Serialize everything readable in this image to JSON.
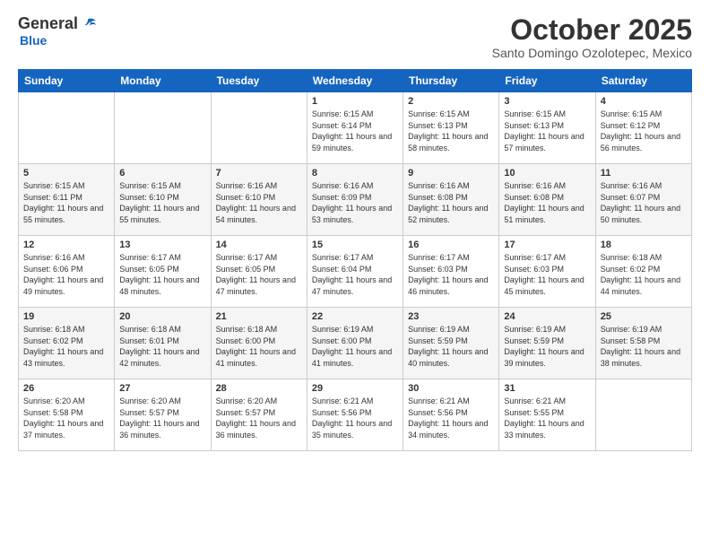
{
  "logo": {
    "general": "General",
    "blue": "Blue"
  },
  "header": {
    "month": "October 2025",
    "location": "Santo Domingo Ozolotepec, Mexico"
  },
  "weekdays": [
    "Sunday",
    "Monday",
    "Tuesday",
    "Wednesday",
    "Thursday",
    "Friday",
    "Saturday"
  ],
  "weeks": [
    [
      {
        "day": "",
        "sunrise": "",
        "sunset": "",
        "daylight": ""
      },
      {
        "day": "",
        "sunrise": "",
        "sunset": "",
        "daylight": ""
      },
      {
        "day": "",
        "sunrise": "",
        "sunset": "",
        "daylight": ""
      },
      {
        "day": "1",
        "sunrise": "Sunrise: 6:15 AM",
        "sunset": "Sunset: 6:14 PM",
        "daylight": "Daylight: 11 hours and 59 minutes."
      },
      {
        "day": "2",
        "sunrise": "Sunrise: 6:15 AM",
        "sunset": "Sunset: 6:13 PM",
        "daylight": "Daylight: 11 hours and 58 minutes."
      },
      {
        "day": "3",
        "sunrise": "Sunrise: 6:15 AM",
        "sunset": "Sunset: 6:13 PM",
        "daylight": "Daylight: 11 hours and 57 minutes."
      },
      {
        "day": "4",
        "sunrise": "Sunrise: 6:15 AM",
        "sunset": "Sunset: 6:12 PM",
        "daylight": "Daylight: 11 hours and 56 minutes."
      }
    ],
    [
      {
        "day": "5",
        "sunrise": "Sunrise: 6:15 AM",
        "sunset": "Sunset: 6:11 PM",
        "daylight": "Daylight: 11 hours and 55 minutes."
      },
      {
        "day": "6",
        "sunrise": "Sunrise: 6:15 AM",
        "sunset": "Sunset: 6:10 PM",
        "daylight": "Daylight: 11 hours and 55 minutes."
      },
      {
        "day": "7",
        "sunrise": "Sunrise: 6:16 AM",
        "sunset": "Sunset: 6:10 PM",
        "daylight": "Daylight: 11 hours and 54 minutes."
      },
      {
        "day": "8",
        "sunrise": "Sunrise: 6:16 AM",
        "sunset": "Sunset: 6:09 PM",
        "daylight": "Daylight: 11 hours and 53 minutes."
      },
      {
        "day": "9",
        "sunrise": "Sunrise: 6:16 AM",
        "sunset": "Sunset: 6:08 PM",
        "daylight": "Daylight: 11 hours and 52 minutes."
      },
      {
        "day": "10",
        "sunrise": "Sunrise: 6:16 AM",
        "sunset": "Sunset: 6:08 PM",
        "daylight": "Daylight: 11 hours and 51 minutes."
      },
      {
        "day": "11",
        "sunrise": "Sunrise: 6:16 AM",
        "sunset": "Sunset: 6:07 PM",
        "daylight": "Daylight: 11 hours and 50 minutes."
      }
    ],
    [
      {
        "day": "12",
        "sunrise": "Sunrise: 6:16 AM",
        "sunset": "Sunset: 6:06 PM",
        "daylight": "Daylight: 11 hours and 49 minutes."
      },
      {
        "day": "13",
        "sunrise": "Sunrise: 6:17 AM",
        "sunset": "Sunset: 6:05 PM",
        "daylight": "Daylight: 11 hours and 48 minutes."
      },
      {
        "day": "14",
        "sunrise": "Sunrise: 6:17 AM",
        "sunset": "Sunset: 6:05 PM",
        "daylight": "Daylight: 11 hours and 47 minutes."
      },
      {
        "day": "15",
        "sunrise": "Sunrise: 6:17 AM",
        "sunset": "Sunset: 6:04 PM",
        "daylight": "Daylight: 11 hours and 47 minutes."
      },
      {
        "day": "16",
        "sunrise": "Sunrise: 6:17 AM",
        "sunset": "Sunset: 6:03 PM",
        "daylight": "Daylight: 11 hours and 46 minutes."
      },
      {
        "day": "17",
        "sunrise": "Sunrise: 6:17 AM",
        "sunset": "Sunset: 6:03 PM",
        "daylight": "Daylight: 11 hours and 45 minutes."
      },
      {
        "day": "18",
        "sunrise": "Sunrise: 6:18 AM",
        "sunset": "Sunset: 6:02 PM",
        "daylight": "Daylight: 11 hours and 44 minutes."
      }
    ],
    [
      {
        "day": "19",
        "sunrise": "Sunrise: 6:18 AM",
        "sunset": "Sunset: 6:02 PM",
        "daylight": "Daylight: 11 hours and 43 minutes."
      },
      {
        "day": "20",
        "sunrise": "Sunrise: 6:18 AM",
        "sunset": "Sunset: 6:01 PM",
        "daylight": "Daylight: 11 hours and 42 minutes."
      },
      {
        "day": "21",
        "sunrise": "Sunrise: 6:18 AM",
        "sunset": "Sunset: 6:00 PM",
        "daylight": "Daylight: 11 hours and 41 minutes."
      },
      {
        "day": "22",
        "sunrise": "Sunrise: 6:19 AM",
        "sunset": "Sunset: 6:00 PM",
        "daylight": "Daylight: 11 hours and 41 minutes."
      },
      {
        "day": "23",
        "sunrise": "Sunrise: 6:19 AM",
        "sunset": "Sunset: 5:59 PM",
        "daylight": "Daylight: 11 hours and 40 minutes."
      },
      {
        "day": "24",
        "sunrise": "Sunrise: 6:19 AM",
        "sunset": "Sunset: 5:59 PM",
        "daylight": "Daylight: 11 hours and 39 minutes."
      },
      {
        "day": "25",
        "sunrise": "Sunrise: 6:19 AM",
        "sunset": "Sunset: 5:58 PM",
        "daylight": "Daylight: 11 hours and 38 minutes."
      }
    ],
    [
      {
        "day": "26",
        "sunrise": "Sunrise: 6:20 AM",
        "sunset": "Sunset: 5:58 PM",
        "daylight": "Daylight: 11 hours and 37 minutes."
      },
      {
        "day": "27",
        "sunrise": "Sunrise: 6:20 AM",
        "sunset": "Sunset: 5:57 PM",
        "daylight": "Daylight: 11 hours and 36 minutes."
      },
      {
        "day": "28",
        "sunrise": "Sunrise: 6:20 AM",
        "sunset": "Sunset: 5:57 PM",
        "daylight": "Daylight: 11 hours and 36 minutes."
      },
      {
        "day": "29",
        "sunrise": "Sunrise: 6:21 AM",
        "sunset": "Sunset: 5:56 PM",
        "daylight": "Daylight: 11 hours and 35 minutes."
      },
      {
        "day": "30",
        "sunrise": "Sunrise: 6:21 AM",
        "sunset": "Sunset: 5:56 PM",
        "daylight": "Daylight: 11 hours and 34 minutes."
      },
      {
        "day": "31",
        "sunrise": "Sunrise: 6:21 AM",
        "sunset": "Sunset: 5:55 PM",
        "daylight": "Daylight: 11 hours and 33 minutes."
      },
      {
        "day": "",
        "sunrise": "",
        "sunset": "",
        "daylight": ""
      }
    ]
  ]
}
